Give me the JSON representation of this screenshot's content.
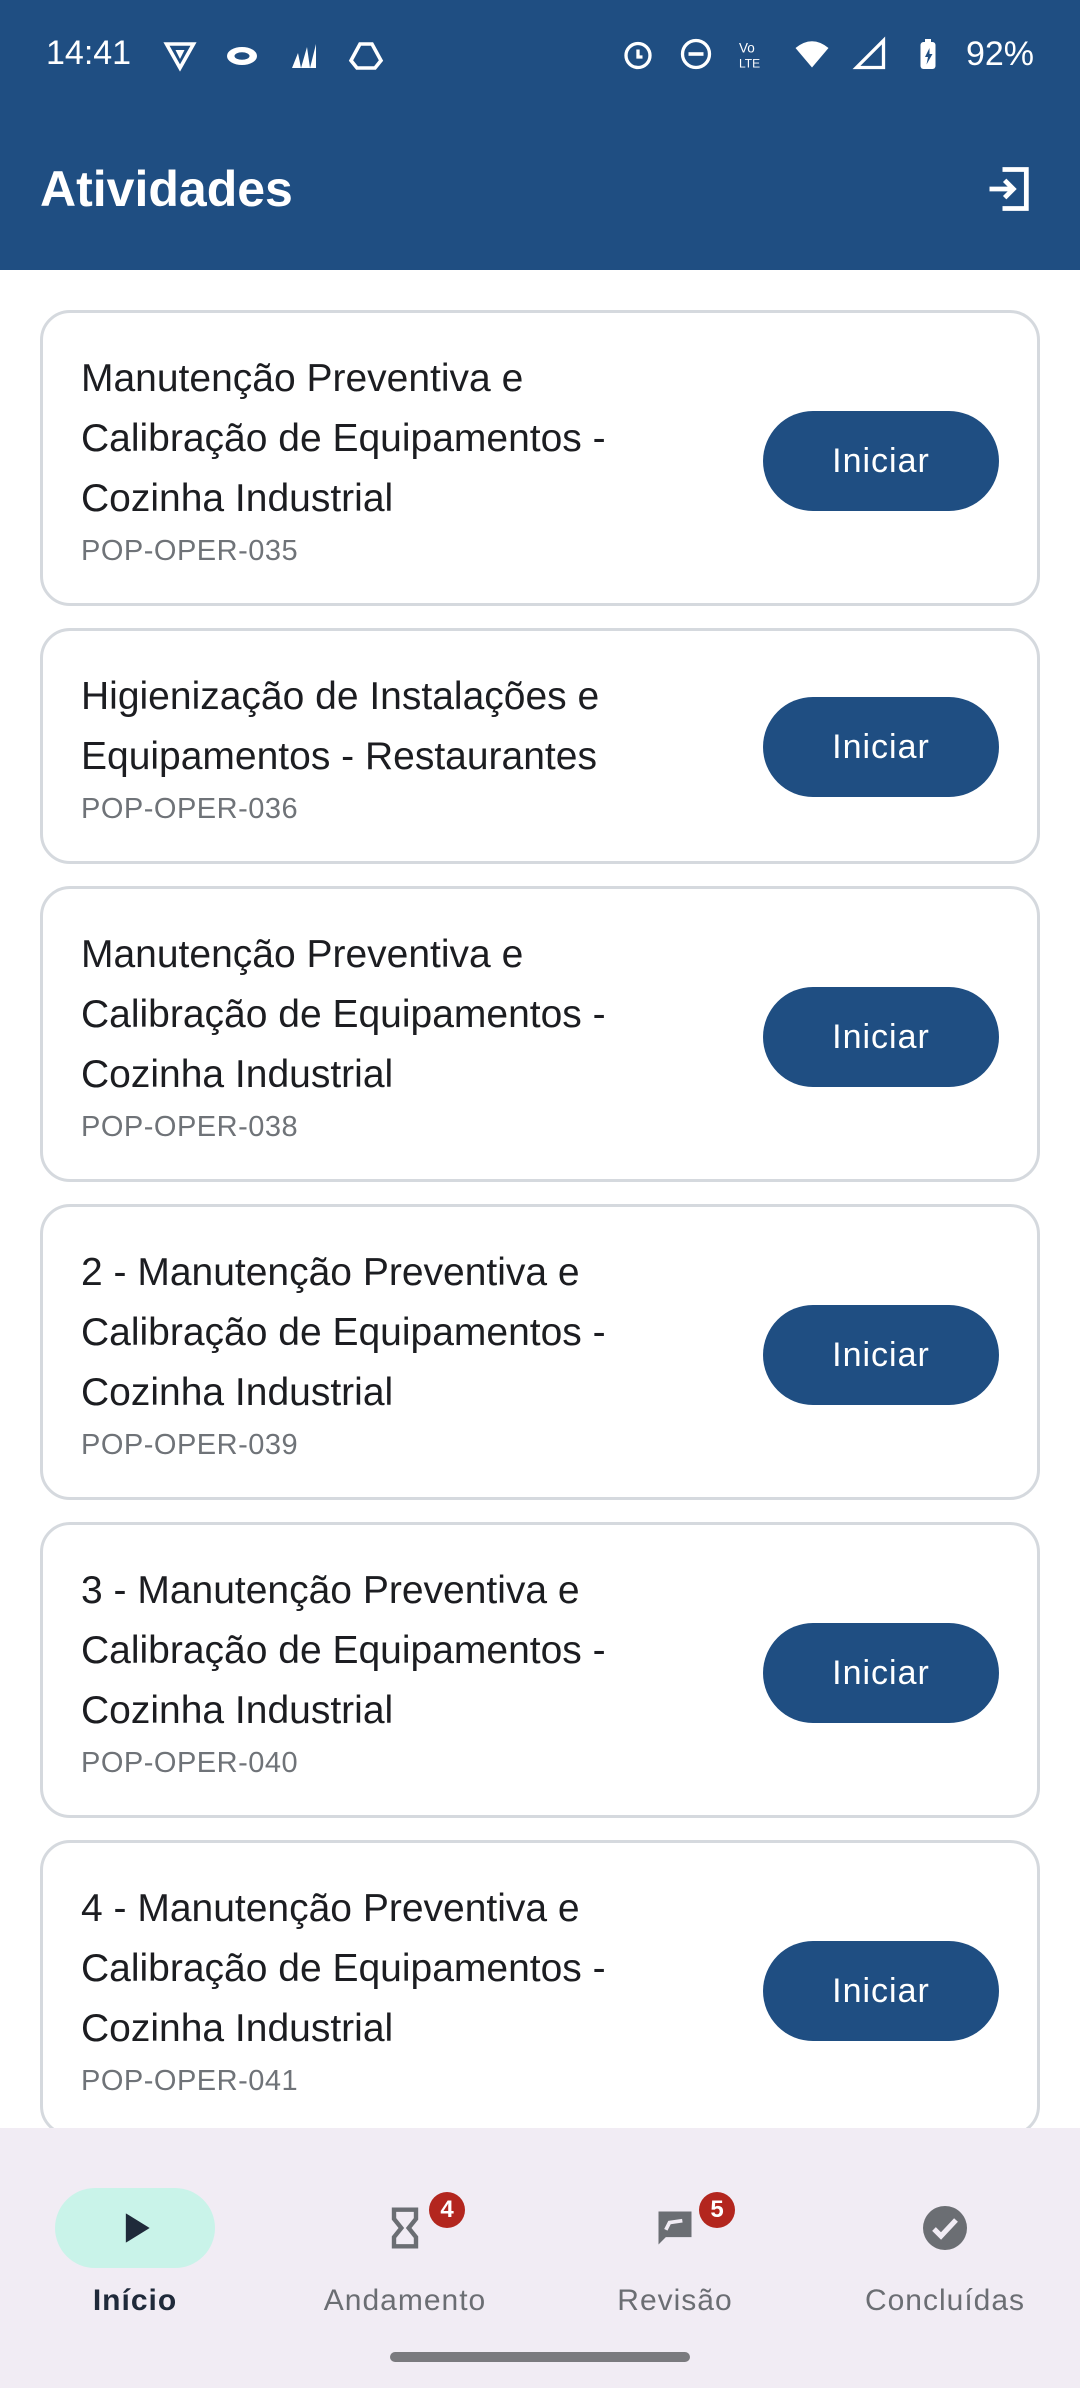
{
  "status": {
    "time": "14:41",
    "battery": "92%",
    "icons": [
      "vpn-icon",
      "eye-icon",
      "wave-icon",
      "drive-icon",
      "alarm-icon",
      "dnd-icon",
      "volte-icon",
      "wifi-icon",
      "signal-icon",
      "battery-icon"
    ]
  },
  "appbar": {
    "title": "Atividades",
    "logout_icon": "logout-icon"
  },
  "activities": [
    {
      "title": "Manutenção Preventiva e Calibração de Equipamentos - Cozinha Industrial",
      "code": "POP-OPER-035",
      "button": "Iniciar"
    },
    {
      "title": "Higienização de Instalações e Equipamentos - Restaurantes",
      "code": "POP-OPER-036",
      "button": "Iniciar"
    },
    {
      "title": "Manutenção Preventiva e Calibração de Equipamentos - Cozinha Industrial",
      "code": "POP-OPER-038",
      "button": "Iniciar"
    },
    {
      "title": "2 - Manutenção Preventiva e Calibração de Equipamentos - Cozinha Industrial",
      "code": "POP-OPER-039",
      "button": "Iniciar"
    },
    {
      "title": "3 - Manutenção Preventiva e Calibração de Equipamentos - Cozinha Industrial",
      "code": "POP-OPER-040",
      "button": "Iniciar"
    },
    {
      "title": "4 - Manutenção Preventiva e Calibração de Equipamentos - Cozinha Industrial",
      "code": "POP-OPER-041",
      "button": "Iniciar"
    }
  ],
  "nav": {
    "items": [
      {
        "label": "Início",
        "icon": "play-icon",
        "active": true,
        "badge": null
      },
      {
        "label": "Andamento",
        "icon": "hourglass-icon",
        "active": false,
        "badge": "4"
      },
      {
        "label": "Revisão",
        "icon": "review-icon",
        "active": false,
        "badge": "5"
      },
      {
        "label": "Concluídas",
        "icon": "check-circle-icon",
        "active": false,
        "badge": null
      }
    ]
  },
  "colors": {
    "primary": "#1f4e82",
    "active_pill": "#c9f3e9",
    "badge": "#b3261e",
    "nav_bg": "#f1ecf4"
  }
}
